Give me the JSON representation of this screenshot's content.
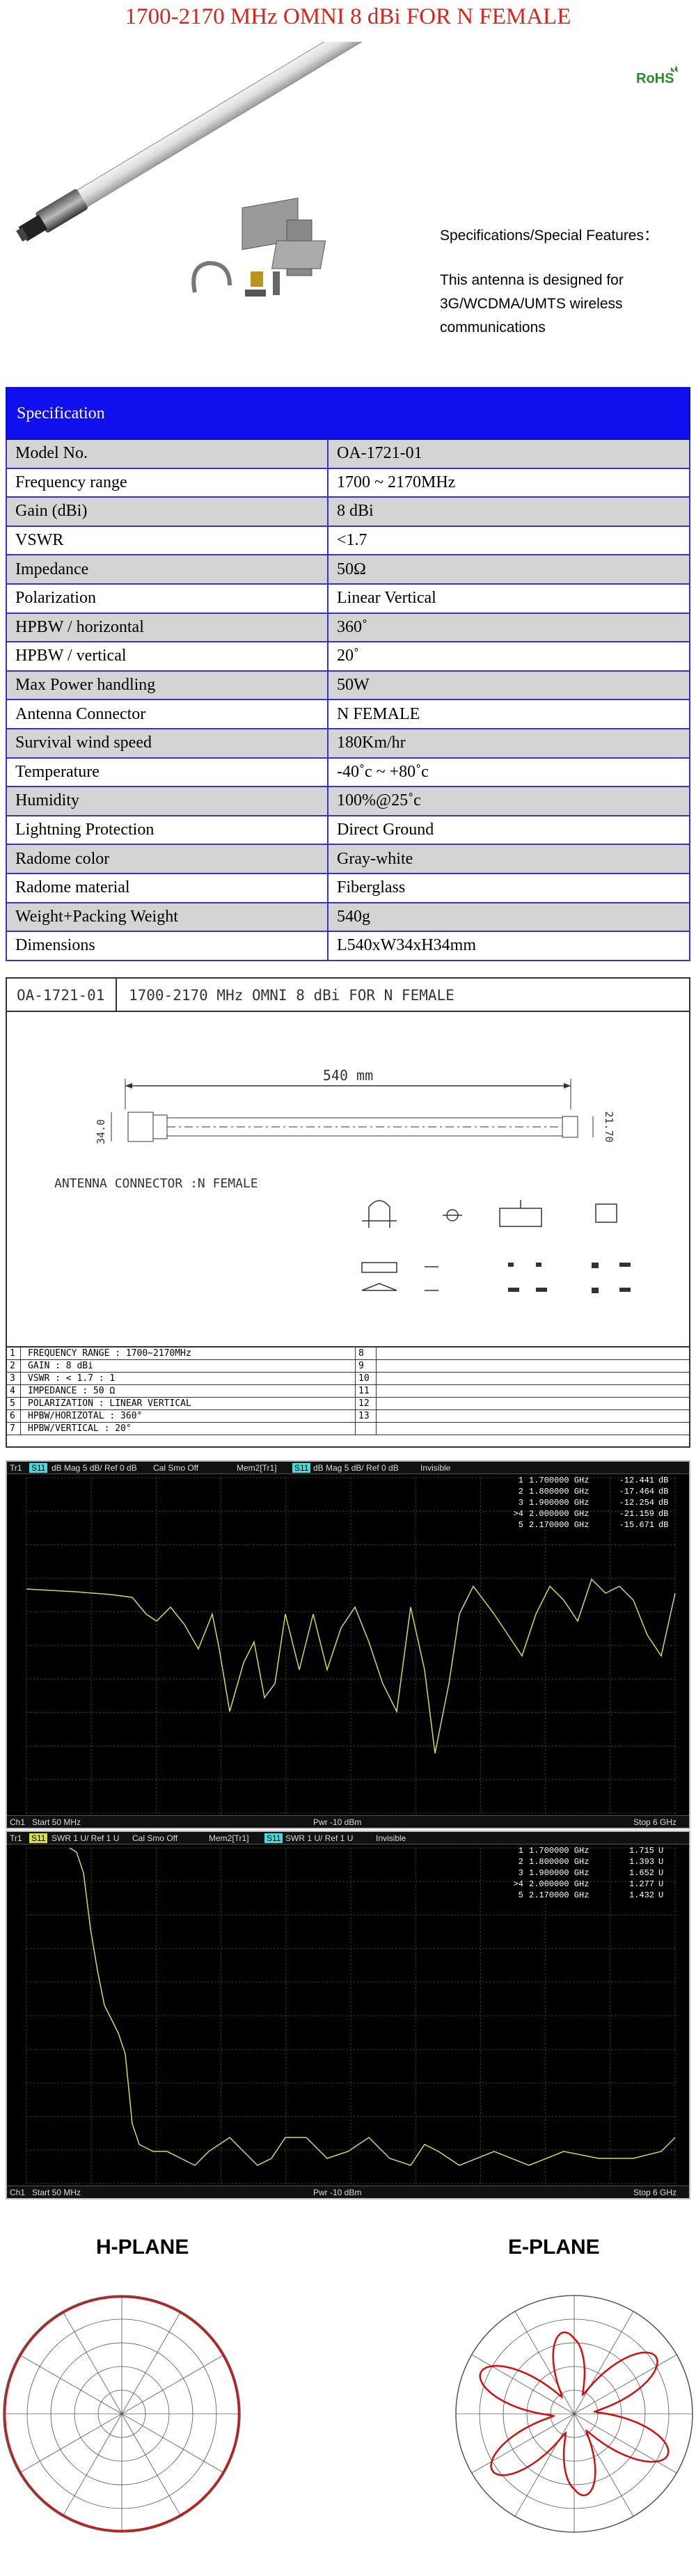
{
  "title": "1700-2170 MHz OMNI 8 dBi FOR N FEMALE",
  "rohs": "RoHS",
  "features": {
    "head": "Specifications/Special Features：",
    "lines": [
      "This antenna is designed for",
      "3G/WCDMA/UMTS wireless",
      "communications"
    ]
  },
  "spec": {
    "header": "Specification",
    "rows": [
      [
        "Model No.",
        "OA-1721-01"
      ],
      [
        "Frequency range",
        "1700 ~ 2170MHz"
      ],
      [
        "Gain (dBi)",
        "8 dBi"
      ],
      [
        "VSWR",
        "<1.7"
      ],
      [
        "Impedance",
        "50Ω"
      ],
      [
        "Polarization",
        "Linear Vertical"
      ],
      [
        "HPBW / horizontal",
        "360˚"
      ],
      [
        "HPBW / vertical",
        "20˚"
      ],
      [
        "Max Power handling",
        "50W"
      ],
      [
        "Antenna Connector",
        "N FEMALE"
      ],
      [
        "Survival wind speed",
        "180Km/hr"
      ],
      [
        "Temperature",
        "-40˚c ~ +80˚c"
      ],
      [
        "Humidity",
        "100%@25˚c"
      ],
      [
        "Lightning Protection",
        "Direct Ground"
      ],
      [
        "Radome color",
        "Gray-white"
      ],
      [
        "Radome material",
        "Fiberglass"
      ],
      [
        "Weight+Packing Weight",
        "540g"
      ],
      [
        "Dimensions",
        "L540xW34xH34mm"
      ]
    ]
  },
  "drawing": {
    "model": "OA-1721-01",
    "title": "1700-2170 MHz OMNI 8 dBi FOR N FEMALE",
    "length": "540 mm",
    "dia_left": "34.0",
    "dia_right": "21.70",
    "connector_label": "ANTENNA CONNECTOR :N FEMALE",
    "rows": [
      [
        "1",
        "FREQUENCY RANGE  : 1700~2170MHz",
        "8"
      ],
      [
        "2",
        "GAIN  : 8 dBi",
        "9"
      ],
      [
        "3",
        "VSWR   : < 1.7 : 1",
        "10"
      ],
      [
        "4",
        "IMPEDANCE : 50 Ω",
        "11"
      ],
      [
        "5",
        "POLARIZATION  : LINEAR VERTICAL",
        "12"
      ],
      [
        "6",
        "HPBW/HORIZOTAL  : 360°",
        "13"
      ],
      [
        "7",
        "HPBW/VERTICAL  : 20°",
        ""
      ]
    ]
  },
  "vna1": {
    "tr": "Tr1",
    "s": "S11",
    "fmt": "dB Mag 5 dB/ Ref 0 dB",
    "cal": "Cal Smo Off",
    "mem": "Mem2[Tr1]",
    "fmt2": "dB Mag 5 dB/ Ref 0 dB",
    "inv": "Invisible",
    "start": "Start 50 MHz",
    "pwr": "Pwr -10 dBm",
    "stop": "Stop 6 GHz",
    "ch": "Ch1",
    "markers": [
      [
        "1",
        "1.700000 GHz",
        "-12.441",
        "dB"
      ],
      [
        "2",
        "1.800000 GHz",
        "-17.464",
        "dB"
      ],
      [
        "3",
        "1.900000 GHz",
        "-12.254",
        "dB"
      ],
      [
        ">4",
        "2.000000 GHz",
        "-21.159",
        "dB"
      ],
      [
        "5",
        "2.170000 GHz",
        "-15.671",
        "dB"
      ]
    ]
  },
  "vna2": {
    "tr": "Tr1",
    "s": "S11",
    "fmt": "SWR 1 U/ Ref 1 U",
    "cal": "Cal Smo Off",
    "mem": "Mem2[Tr1]",
    "fmt2": "SWR 1 U/ Ref 1 U",
    "inv": "Invisible",
    "start": "Start 50 MHz",
    "pwr": "Pwr -10 dBm",
    "stop": "Stop 6 GHz",
    "ch": "Ch1",
    "markers": [
      [
        "1",
        "1.700000 GHz",
        "1.715",
        "U"
      ],
      [
        "2",
        "1.800000 GHz",
        "1.393",
        "U"
      ],
      [
        "3",
        "1.900000 GHz",
        "1.652",
        "U"
      ],
      [
        ">4",
        "2.000000 GHz",
        "1.277",
        "U"
      ],
      [
        "5",
        "2.170000 GHz",
        "1.432",
        "U"
      ]
    ]
  },
  "polar": {
    "h_title": "H-PLANE",
    "e_title": "E-PLANE",
    "pattern_color": "#cc1111"
  }
}
